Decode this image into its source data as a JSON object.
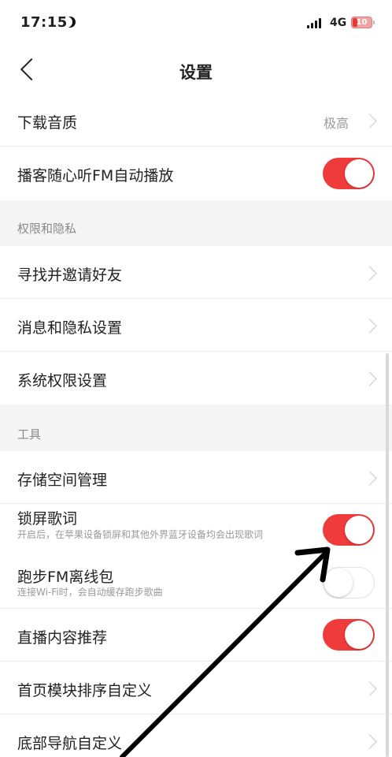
{
  "status_bar": {
    "time": "17:15",
    "network": "4G",
    "battery": "10"
  },
  "nav": {
    "title": "设置"
  },
  "rows": {
    "download_quality": {
      "label": "下载音质",
      "value": "极高"
    },
    "podcast_fm_autoplay": {
      "label": "播客随心听FM自动播放",
      "toggle": "on"
    },
    "find_invite_friends": {
      "label": "寻找并邀请好友"
    },
    "message_privacy": {
      "label": "消息和隐私设置"
    },
    "system_permissions": {
      "label": "系统权限设置"
    },
    "storage_management": {
      "label": "存储空间管理"
    },
    "lock_screen_lyrics": {
      "label": "锁屏歌词",
      "sub": "开启后，在苹果设备锁屏和其他外界蓝牙设备均会出现歌词",
      "toggle": "on"
    },
    "running_fm_offline": {
      "label": "跑步FM离线包",
      "sub": "连接Wi-Fi时，会自动缓存跑步歌曲",
      "toggle": "off"
    },
    "live_recommend": {
      "label": "直播内容推荐",
      "toggle": "on"
    },
    "homepage_module_order": {
      "label": "首页模块排序自定义"
    },
    "bottom_nav_custom": {
      "label": "底部导航自定义"
    }
  },
  "sections": {
    "privacy": "权限和隐私",
    "tools": "工具"
  },
  "colors": {
    "accent": "#ef3b3b",
    "annotation_arrow": "#000000"
  }
}
